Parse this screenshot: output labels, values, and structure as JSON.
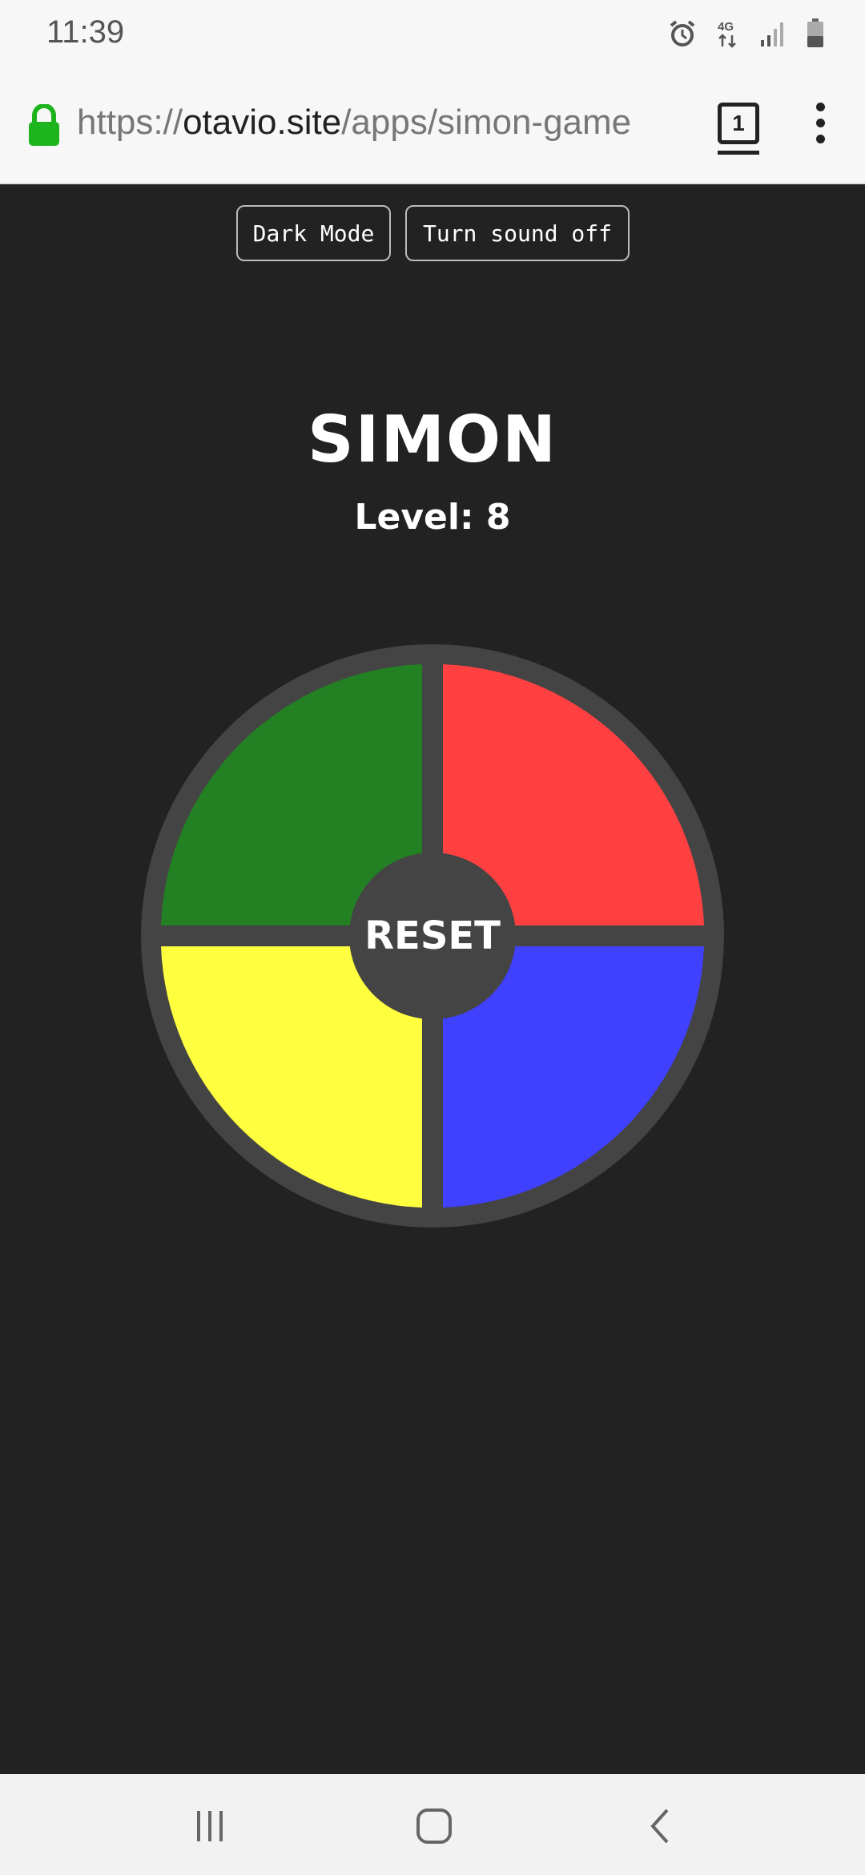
{
  "status_bar": {
    "time": "11:39",
    "icons": [
      "alarm-icon",
      "4g-icon",
      "signal-icon",
      "battery-icon"
    ],
    "network_label": "4G"
  },
  "browser": {
    "url_scheme": "https://",
    "url_host": "otavio.site",
    "url_path": "/apps/simon-game",
    "tab_count": "1"
  },
  "toolbar": {
    "dark_mode_label": "Dark Mode",
    "sound_label": "Turn sound off"
  },
  "game": {
    "title": "SIMON",
    "level_text": "Level: 8",
    "reset_label": "RESET",
    "colors": {
      "green": "#238023",
      "red": "#ff4040",
      "yellow": "#ffff40",
      "blue": "#4040ff",
      "board": "#444444",
      "background": "#222222"
    }
  },
  "nav": {
    "items": [
      "recent-apps-icon",
      "home-icon",
      "back-icon"
    ]
  }
}
